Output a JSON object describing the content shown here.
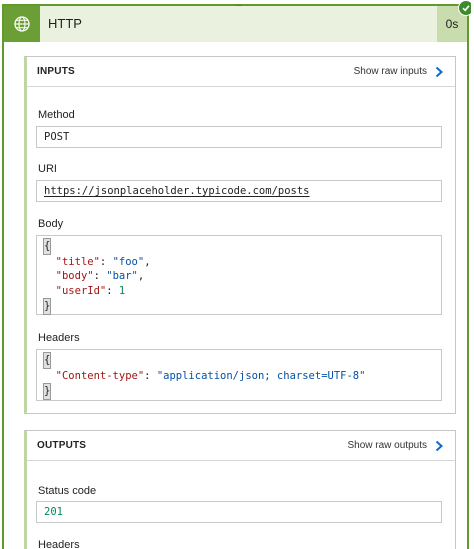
{
  "card": {
    "title": "HTTP",
    "duration": "0s",
    "accent_color": "#6b9e35",
    "header_bg": "#eaf1de",
    "status_icon": "check-icon",
    "action_icon": "globe-icon"
  },
  "inputs": {
    "title": "INPUTS",
    "show_raw_label": "Show raw inputs",
    "method_label": "Method",
    "method_value": "POST",
    "uri_label": "URI",
    "uri_value": "https://jsonplaceholder.typicode.com/posts",
    "body_label": "Body",
    "body_lines": {
      "open": "{",
      "l1_key": "\"title\"",
      "l1_val": "\"foo\"",
      "l2_key": "\"body\"",
      "l2_val": "\"bar\"",
      "l3_key": "\"userId\"",
      "l3_val": "1",
      "close": "}"
    },
    "headers_label": "Headers",
    "headers_lines": {
      "open": "{",
      "l1_key": "\"Content-type\"",
      "l1_val": "\"application/json; charset=UTF-8\"",
      "close": "}"
    }
  },
  "outputs": {
    "title": "OUTPUTS",
    "show_raw_label": "Show raw outputs",
    "status_label": "Status code",
    "status_value": "201",
    "headers_label": "Headers"
  }
}
